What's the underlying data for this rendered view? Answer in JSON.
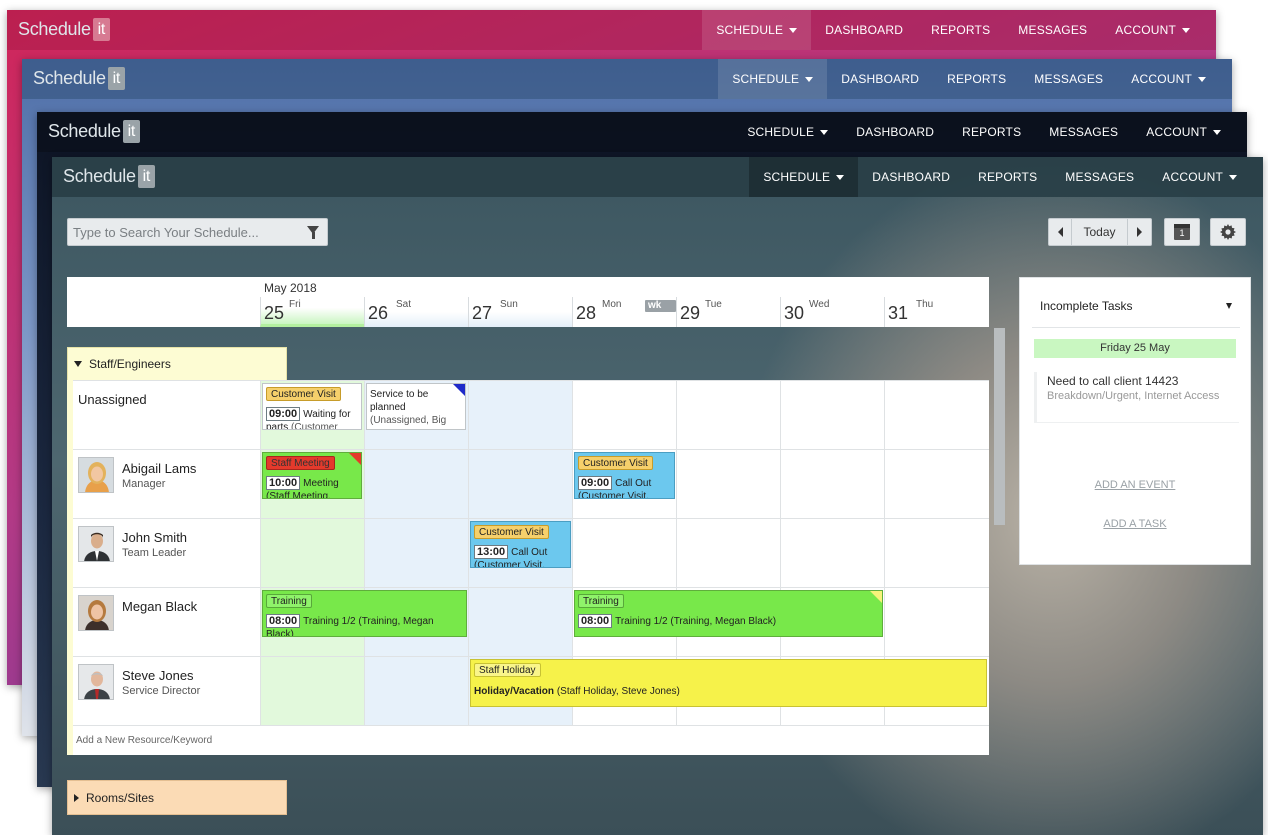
{
  "app": {
    "logo_text": "Schedule",
    "logo_badge": "it"
  },
  "nav": {
    "items": [
      {
        "label": "SCHEDULE",
        "has_caret": true
      },
      {
        "label": "DASHBOARD"
      },
      {
        "label": "REPORTS"
      },
      {
        "label": "MESSAGES"
      },
      {
        "label": "ACCOUNT",
        "has_caret": true
      }
    ]
  },
  "toolbar": {
    "search_placeholder": "Type to Search Your Schedule...",
    "today_label": "Today",
    "calendar_day": "1"
  },
  "calendar": {
    "month": "May 2018",
    "week_label": "wk 22",
    "days": [
      {
        "num": "25",
        "name": "Fri"
      },
      {
        "num": "26",
        "name": "Sat"
      },
      {
        "num": "27",
        "name": "Sun"
      },
      {
        "num": "28",
        "name": "Mon"
      },
      {
        "num": "29",
        "name": "Tue"
      },
      {
        "num": "30",
        "name": "Wed"
      },
      {
        "num": "31",
        "name": "Thu"
      }
    ]
  },
  "groups": {
    "staff": "Staff/Engineers",
    "rooms": "Rooms/Sites",
    "add_resource": "Add a New Resource/Keyword"
  },
  "resources": [
    {
      "name": "Unassigned",
      "role": ""
    },
    {
      "name": "Abigail Lams",
      "role": "Manager"
    },
    {
      "name": "John Smith",
      "role": "Team Leader"
    },
    {
      "name": "Megan Black",
      "role": ""
    },
    {
      "name": "Steve Jones",
      "role": "Service Director"
    }
  ],
  "events": {
    "e1": {
      "tag": "Customer Visit",
      "time": "09:00",
      "text": "Waiting for parts",
      "sub": "(Customer"
    },
    "e2": {
      "title": "Service to be planned",
      "sub": "(Unassigned, Big"
    },
    "e3": {
      "tag": "Staff Meeting",
      "time": "10:00",
      "text": "Meeting",
      "sub": "(Staff Meeting,"
    },
    "e4": {
      "tag": "Customer Visit",
      "time": "09:00",
      "text": "Call Out",
      "sub": "(Customer Visit,"
    },
    "e5": {
      "tag": "Customer Visit",
      "time": "13:00",
      "text": "Call Out",
      "sub": "(Customer Visit,"
    },
    "e6": {
      "tag": "Training",
      "time": "08:00",
      "text": "Training 1/2",
      "sub": "(Training, Megan Black)"
    },
    "e7": {
      "tag": "Training",
      "time": "08:00",
      "text": "Training 1/2",
      "sub": "(Training, Megan Black)"
    },
    "e8": {
      "tag": "Staff Holiday",
      "text": "Holiday/Vacation",
      "sub": "(Staff Holiday, Steve Jones)"
    }
  },
  "panel": {
    "title": "Incomplete Tasks",
    "day": "Friday 25 May",
    "task_title": "Need to call client 14423",
    "task_sub": "Breakdown/Urgent, Internet Access",
    "add_event": "ADD AN EVENT",
    "add_task": "ADD A TASK"
  },
  "colors": {
    "event_green": "#78e84a",
    "event_blue": "#6cc8ee",
    "event_yellow": "#f6f24a",
    "tag_orange": "#f6d06b",
    "tag_red": "#e43a2c",
    "selected_day": "#c9f7c1",
    "group_staff": "#fdfcd3",
    "group_rooms": "#fbdbb5"
  }
}
